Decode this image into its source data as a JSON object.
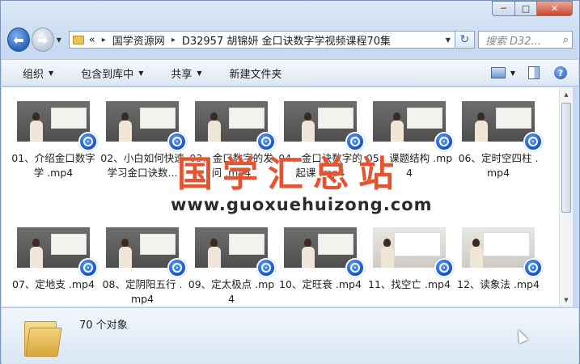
{
  "window": {
    "caption": {
      "minimize": "─",
      "maximize": "□",
      "close": "✕"
    }
  },
  "nav": {
    "back_icon": "back-arrow-icon",
    "forward_icon": "forward-arrow-icon",
    "breadcrumb_overflow": "«",
    "breadcrumb": [
      "国学资源网",
      "D32957 胡锦妍 金口诀数字学视频课程70集"
    ],
    "breadcrumb_sep": "▸",
    "search_placeholder": "搜索 D32...",
    "refresh_glyph": "↻",
    "search_glyph": "⌕"
  },
  "toolbar": {
    "organize": "组织",
    "include_in_library": "包含到库中",
    "share": "共享",
    "new_folder": "新建文件夹",
    "help": "?"
  },
  "files": [
    {
      "name": "01、介绍金口数字学 .mp4"
    },
    {
      "name": "02、小白如何快速学习金口诀数..."
    },
    {
      "name": "03、金口数字的发问 .mp4"
    },
    {
      "name": "04、金口诀数字的起课 .mp4"
    },
    {
      "name": "05、课题结构 .mp4"
    },
    {
      "name": "06、定时空四柱 .mp4"
    },
    {
      "name": "07、定地支 .mp4"
    },
    {
      "name": "08、定阴阳五行 .mp4"
    },
    {
      "name": "09、定太极点 .mp4"
    },
    {
      "name": "10、定旺衰 .mp4"
    },
    {
      "name": "11、找空亡 .mp4"
    },
    {
      "name": "12、读象法 .mp4"
    }
  ],
  "watermark": {
    "title": "国学汇总站",
    "url": "www.guoxuehuizong.com"
  },
  "details": {
    "count": "70 个对象"
  },
  "colors": {
    "watermark_title": "#e14119",
    "badge": "#1853c9",
    "accent": "#2a63b8"
  }
}
